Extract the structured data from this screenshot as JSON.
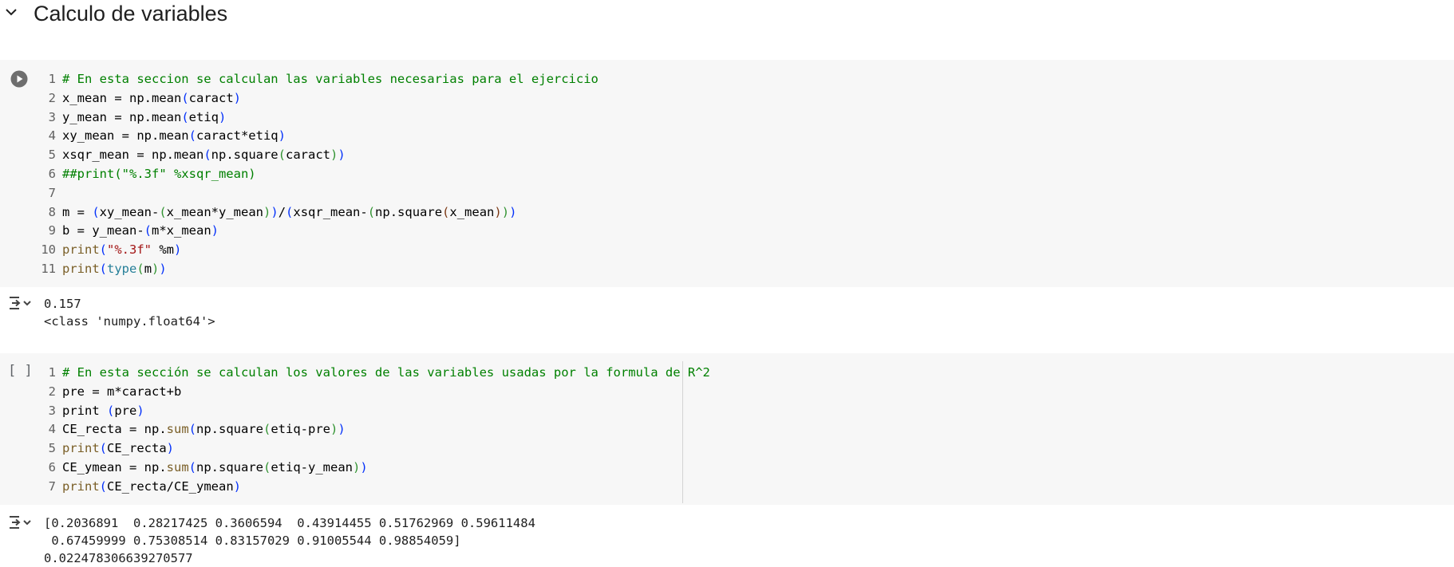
{
  "section": {
    "title": "Calculo de variables",
    "chevron_icon": "chevron-down-icon"
  },
  "cells": [
    {
      "run_icon": "play-circle-icon",
      "lines": [
        {
          "n": "1",
          "tokens": [
            {
              "t": "# En esta seccion se calculan las variables necesarias para el ejercicio",
              "c": "c-com"
            }
          ]
        },
        {
          "n": "2",
          "tokens": [
            {
              "t": "x_mean = np.mean",
              "c": ""
            },
            {
              "t": "(",
              "c": "c-p1"
            },
            {
              "t": "caract",
              "c": ""
            },
            {
              "t": ")",
              "c": "c-p1"
            }
          ]
        },
        {
          "n": "3",
          "tokens": [
            {
              "t": "y_mean = np.mean",
              "c": ""
            },
            {
              "t": "(",
              "c": "c-p1"
            },
            {
              "t": "etiq",
              "c": ""
            },
            {
              "t": ")",
              "c": "c-p1"
            }
          ]
        },
        {
          "n": "4",
          "tokens": [
            {
              "t": "xy_mean = np.mean",
              "c": ""
            },
            {
              "t": "(",
              "c": "c-p1"
            },
            {
              "t": "caract*etiq",
              "c": ""
            },
            {
              "t": ")",
              "c": "c-p1"
            }
          ]
        },
        {
          "n": "5",
          "tokens": [
            {
              "t": "xsqr_mean = np.mean",
              "c": ""
            },
            {
              "t": "(",
              "c": "c-p1"
            },
            {
              "t": "np.square",
              "c": ""
            },
            {
              "t": "(",
              "c": "c-p2"
            },
            {
              "t": "caract",
              "c": ""
            },
            {
              "t": ")",
              "c": "c-p2"
            },
            {
              "t": ")",
              "c": "c-p1"
            }
          ]
        },
        {
          "n": "6",
          "tokens": [
            {
              "t": "##print(\"%.3f\" %xsqr_mean)",
              "c": "c-com"
            }
          ]
        },
        {
          "n": "7",
          "tokens": [
            {
              "t": "",
              "c": ""
            }
          ]
        },
        {
          "n": "8",
          "tokens": [
            {
              "t": "m = ",
              "c": ""
            },
            {
              "t": "(",
              "c": "c-p1"
            },
            {
              "t": "xy_mean-",
              "c": ""
            },
            {
              "t": "(",
              "c": "c-p2"
            },
            {
              "t": "x_mean*y_mean",
              "c": ""
            },
            {
              "t": ")",
              "c": "c-p2"
            },
            {
              "t": ")",
              "c": "c-p1"
            },
            {
              "t": "/",
              "c": ""
            },
            {
              "t": "(",
              "c": "c-p1"
            },
            {
              "t": "xsqr_mean-",
              "c": ""
            },
            {
              "t": "(",
              "c": "c-p2"
            },
            {
              "t": "np.square",
              "c": ""
            },
            {
              "t": "(",
              "c": "c-p3"
            },
            {
              "t": "x_mean",
              "c": ""
            },
            {
              "t": ")",
              "c": "c-p3"
            },
            {
              "t": ")",
              "c": "c-p2"
            },
            {
              "t": ")",
              "c": "c-p1"
            }
          ]
        },
        {
          "n": "9",
          "tokens": [
            {
              "t": "b = y_mean-",
              "c": ""
            },
            {
              "t": "(",
              "c": "c-p1"
            },
            {
              "t": "m*x_mean",
              "c": ""
            },
            {
              "t": ")",
              "c": "c-p1"
            }
          ]
        },
        {
          "n": "10",
          "tokens": [
            {
              "t": "print",
              "c": "c-fn"
            },
            {
              "t": "(",
              "c": "c-p1"
            },
            {
              "t": "\"%.3f\"",
              "c": "c-str"
            },
            {
              "t": " %m",
              "c": ""
            },
            {
              "t": ")",
              "c": "c-p1"
            }
          ]
        },
        {
          "n": "11",
          "tokens": [
            {
              "t": "print",
              "c": "c-fn"
            },
            {
              "t": "(",
              "c": "c-p1"
            },
            {
              "t": "type",
              "c": "c-bi"
            },
            {
              "t": "(",
              "c": "c-p2"
            },
            {
              "t": "m",
              "c": ""
            },
            {
              "t": ")",
              "c": "c-p2"
            },
            {
              "t": ")",
              "c": "c-p1"
            }
          ]
        }
      ],
      "output": {
        "icon": "output-toggle-icon",
        "text": "0.157\n<class 'numpy.float64'>"
      }
    },
    {
      "brackets": "[ ]",
      "lines": [
        {
          "n": "1",
          "tokens": [
            {
              "t": "# En esta sección se calculan los valores de las variables usadas por la formula de R^2",
              "c": "c-com"
            }
          ]
        },
        {
          "n": "2",
          "tokens": [
            {
              "t": "pre = m*caract+b",
              "c": ""
            }
          ]
        },
        {
          "n": "3",
          "tokens": [
            {
              "t": "print ",
              "c": ""
            },
            {
              "t": "(",
              "c": "c-p1"
            },
            {
              "t": "pre",
              "c": ""
            },
            {
              "t": ")",
              "c": "c-p1"
            }
          ]
        },
        {
          "n": "4",
          "tokens": [
            {
              "t": "CE_recta = np.",
              "c": ""
            },
            {
              "t": "sum",
              "c": "c-fn"
            },
            {
              "t": "(",
              "c": "c-p1"
            },
            {
              "t": "np.square",
              "c": ""
            },
            {
              "t": "(",
              "c": "c-p2"
            },
            {
              "t": "etiq-pre",
              "c": ""
            },
            {
              "t": ")",
              "c": "c-p2"
            },
            {
              "t": ")",
              "c": "c-p1"
            }
          ]
        },
        {
          "n": "5",
          "tokens": [
            {
              "t": "print",
              "c": "c-fn"
            },
            {
              "t": "(",
              "c": "c-p1"
            },
            {
              "t": "CE_recta",
              "c": ""
            },
            {
              "t": ")",
              "c": "c-p1"
            }
          ]
        },
        {
          "n": "6",
          "tokens": [
            {
              "t": "CE_ymean = np.",
              "c": ""
            },
            {
              "t": "sum",
              "c": "c-fn"
            },
            {
              "t": "(",
              "c": "c-p1"
            },
            {
              "t": "np.square",
              "c": ""
            },
            {
              "t": "(",
              "c": "c-p2"
            },
            {
              "t": "etiq-y_mean",
              "c": ""
            },
            {
              "t": ")",
              "c": "c-p2"
            },
            {
              "t": ")",
              "c": "c-p1"
            }
          ]
        },
        {
          "n": "7",
          "tokens": [
            {
              "t": "print",
              "c": "c-fn"
            },
            {
              "t": "(",
              "c": "c-p1"
            },
            {
              "t": "CE_recta/CE_ymean",
              "c": ""
            },
            {
              "t": ")",
              "c": "c-p1"
            }
          ]
        }
      ],
      "output": {
        "icon": "output-toggle-icon",
        "text": "[0.2036891  0.28217425 0.3606594  0.43914455 0.51762969 0.59611484\n 0.67459999 0.75308514 0.83157029 0.91005544 0.98854059]\n0.022478306639270577"
      }
    }
  ]
}
